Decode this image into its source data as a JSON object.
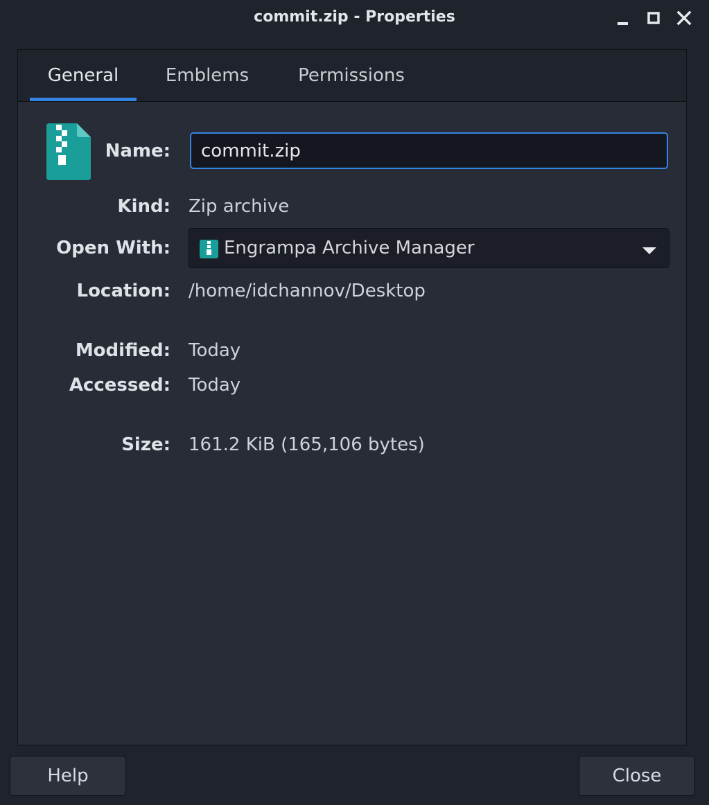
{
  "window": {
    "title": "commit.zip - Properties"
  },
  "tabs": [
    {
      "label": "General",
      "active": true
    },
    {
      "label": "Emblems",
      "active": false
    },
    {
      "label": "Permissions",
      "active": false
    }
  ],
  "general": {
    "file_icon": "zip-archive-icon",
    "name": {
      "label": "Name:",
      "value": "commit.zip"
    },
    "kind": {
      "label": "Kind:",
      "value": "Zip archive"
    },
    "open_with": {
      "label": "Open With:",
      "value": "Engrampa Archive Manager",
      "icon": "engrampa-icon"
    },
    "location": {
      "label": "Location:",
      "value": "/home/idchannov/Desktop"
    },
    "modified": {
      "label": "Modified:",
      "value": "Today"
    },
    "accessed": {
      "label": "Accessed:",
      "value": "Today"
    },
    "size": {
      "label": "Size:",
      "value": "161.2 KiB (165,106 bytes)"
    }
  },
  "buttons": {
    "help": "Help",
    "close": "Close"
  },
  "colors": {
    "accent": "#3584e4",
    "archive_icon": "#1a9e9a",
    "background": "#282c37",
    "titlebar": "#1f232c"
  }
}
